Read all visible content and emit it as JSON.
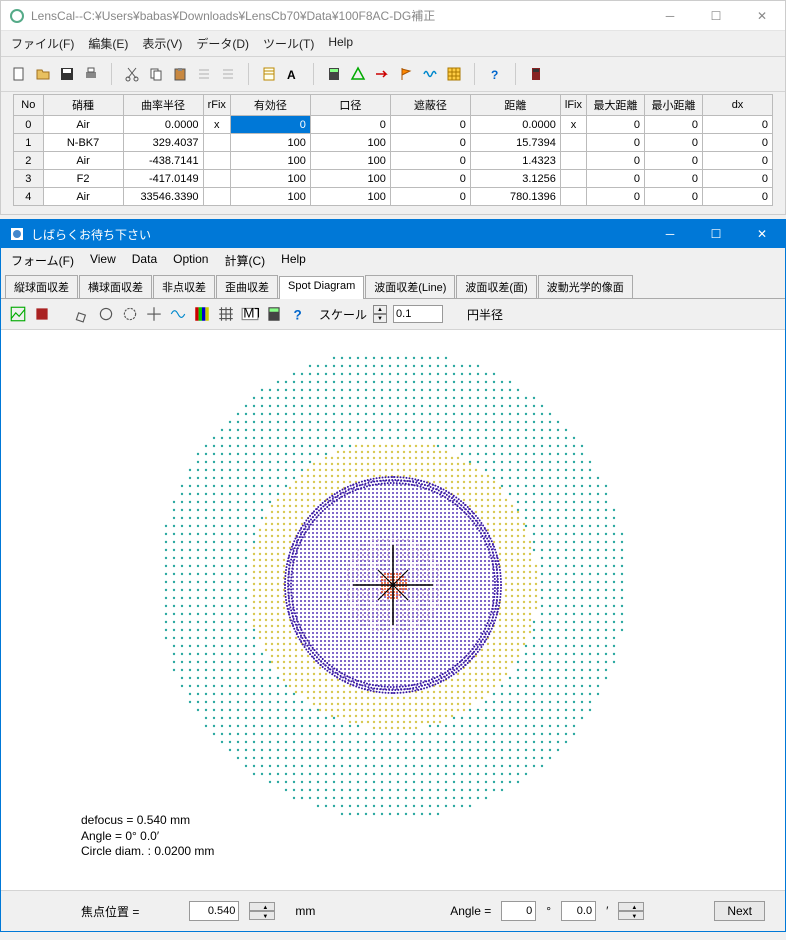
{
  "main": {
    "title": "LensCal--C:¥Users¥babas¥Downloads¥LensCb70¥Data¥100F8AC-DG補正",
    "menu": {
      "file": "ファイル(F)",
      "edit": "編集(E)",
      "view": "表示(V)",
      "data": "データ(D)",
      "tool": "ツール(T)",
      "help": "Help"
    }
  },
  "table": {
    "headers": {
      "no": "No",
      "glass": "硝種",
      "radius": "曲率半径",
      "rfix": "rFix",
      "eff": "有効径",
      "aperture": "口径",
      "block": "遮蔽径",
      "dist": "距離",
      "lfix": "lFix",
      "maxd": "最大距離",
      "mind": "最小距離",
      "dx": "dx"
    },
    "rows": [
      {
        "no": "0",
        "glass": "Air",
        "radius": "0.0000",
        "rfix": "x",
        "eff": "0",
        "ap": "0",
        "blk": "0",
        "dist": "0.0000",
        "lfix": "x",
        "max": "0",
        "min": "0",
        "dx": "0",
        "sel": true
      },
      {
        "no": "1",
        "glass": "N-BK7",
        "radius": "329.4037",
        "rfix": "",
        "eff": "100",
        "ap": "100",
        "blk": "0",
        "dist": "15.7394",
        "lfix": "",
        "max": "0",
        "min": "0",
        "dx": "0"
      },
      {
        "no": "2",
        "glass": "Air",
        "radius": "-438.7141",
        "rfix": "",
        "eff": "100",
        "ap": "100",
        "blk": "0",
        "dist": "1.4323",
        "lfix": "",
        "max": "0",
        "min": "0",
        "dx": "0"
      },
      {
        "no": "3",
        "glass": "F2",
        "radius": "-417.0149",
        "rfix": "",
        "eff": "100",
        "ap": "100",
        "blk": "0",
        "dist": "3.1256",
        "lfix": "",
        "max": "0",
        "min": "0",
        "dx": "0"
      },
      {
        "no": "4",
        "glass": "Air",
        "radius": "33546.3390",
        "rfix": "",
        "eff": "100",
        "ap": "100",
        "blk": "0",
        "dist": "780.1396",
        "lfix": "",
        "max": "0",
        "min": "0",
        "dx": "0"
      }
    ]
  },
  "sub": {
    "title": "しばらくお待ち下さい",
    "menu": {
      "form": "フォーム(F)",
      "view": "View",
      "data": "Data",
      "option": "Option",
      "calc": "計算(C)",
      "help": "Help"
    },
    "tabs": [
      "縦球面収差",
      "横球面収差",
      "非点収差",
      "歪曲収差",
      "Spot Diagram",
      "波面収差(Line)",
      "波面収差(面)",
      "波動光学的像面"
    ],
    "active_tab": 4,
    "scale_label": "スケール",
    "scale_value": "0.1",
    "radius_label": "円半径",
    "text": {
      "defocus": "defocus = 0.540 mm",
      "angle": "Angle  =  0° 0.0′",
      "circle": "Circle diam. : 0.0200 mm"
    },
    "bottom": {
      "focus_label": "焦点位置 =",
      "focus_value": "0.540",
      "focus_unit": "mm",
      "angle_label": "Angle =",
      "angle_deg": "0",
      "angle_min": "0.0",
      "deg_sym": "°",
      "min_sym": "′",
      "next": "Next"
    }
  }
}
